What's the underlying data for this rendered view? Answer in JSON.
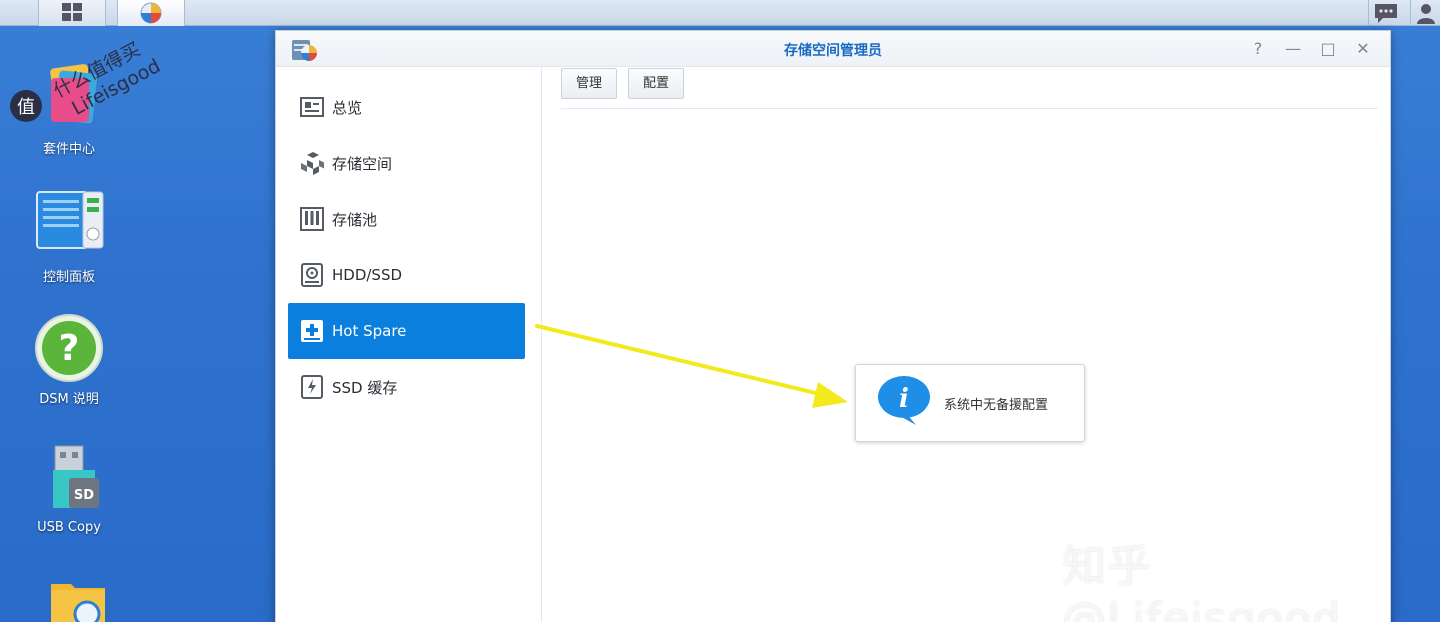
{
  "desktop": {
    "icons": [
      {
        "label": "套件中心"
      },
      {
        "label": "控制面板"
      },
      {
        "label": "DSM 说明"
      },
      {
        "label": "USB Copy"
      },
      {
        "label": ""
      }
    ],
    "usb_badge": "SD",
    "help_glyph": "?"
  },
  "watermark": {
    "top_badge": "值",
    "top_line1": "什么值得买",
    "top_line2": "Lifeisgood",
    "bottom": "知乎 @Lifeisgood"
  },
  "window": {
    "title": "存储空间管理员",
    "controls": {
      "help": "?",
      "minimize": "—",
      "maximize": "□",
      "close": "✕"
    },
    "sidebar": {
      "items": [
        {
          "label": "总览",
          "icon": "overview-icon"
        },
        {
          "label": "存储空间",
          "icon": "volume-icon"
        },
        {
          "label": "存储池",
          "icon": "storage-pool-icon"
        },
        {
          "label": "HDD/SSD",
          "icon": "disk-icon"
        },
        {
          "label": "Hot Spare",
          "icon": "hot-spare-icon",
          "active": true
        },
        {
          "label": "SSD 缓存",
          "icon": "ssd-cache-icon"
        }
      ]
    },
    "toolbar": {
      "manage_label": "管理",
      "config_label": "配置"
    },
    "info_message": "系统中无备援配置"
  },
  "colors": {
    "accent": "#0b7fde",
    "title": "#1b6ac2",
    "desktop": "#2f73cf",
    "arrow": "#f2ea1c"
  }
}
